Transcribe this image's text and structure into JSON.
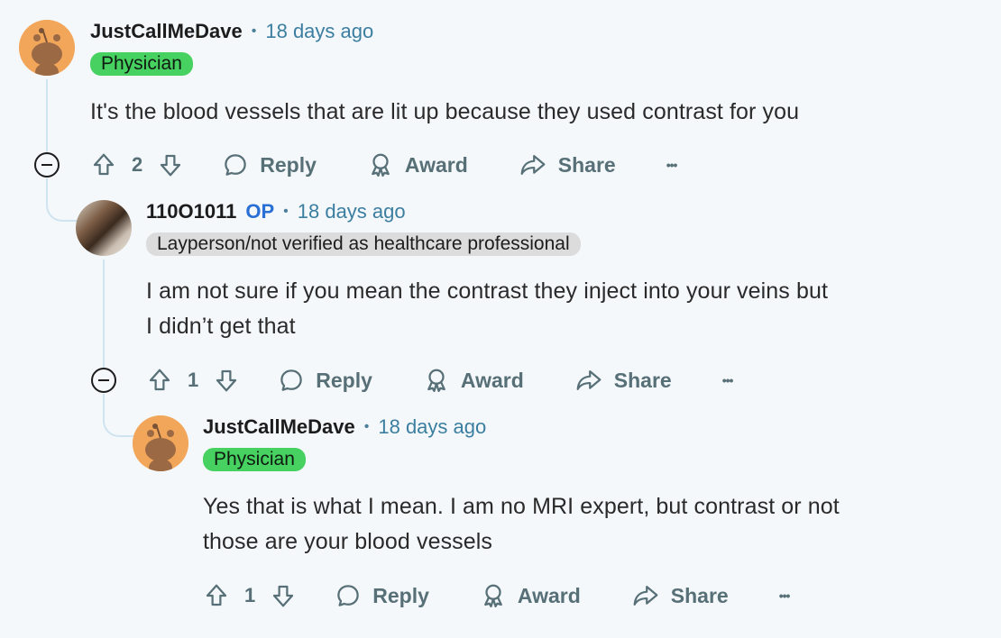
{
  "comments": [
    {
      "username": "JustCallMeDave",
      "separator": "•",
      "time": "18 days ago",
      "flair": "Physician",
      "body_lines": [
        "It's the blood vessels that are lit up because they used contrast for you"
      ],
      "votes": "2",
      "actions": {
        "reply": "Reply",
        "award": "Award",
        "share": "Share",
        "more": "•••"
      }
    },
    {
      "username": "110O1011",
      "op_badge": "OP",
      "separator": "•",
      "time": "18 days ago",
      "flair": "Layperson/not verified as healthcare professional",
      "body_lines": [
        "I am not sure if you mean the contrast they inject into your veins but",
        "I didn’t get that"
      ],
      "votes": "1",
      "actions": {
        "reply": "Reply",
        "award": "Award",
        "share": "Share",
        "more": "•••"
      }
    },
    {
      "username": "JustCallMeDave",
      "separator": "•",
      "time": "18 days ago",
      "flair": "Physician",
      "body_lines": [
        "Yes that is what I mean. I am no MRI expert, but contrast or not",
        "those are your blood vessels"
      ],
      "votes": "1",
      "actions": {
        "reply": "Reply",
        "award": "Award",
        "share": "Share",
        "more": "•••"
      }
    }
  ],
  "colors": {
    "background": "#f4f8fb",
    "flair_green": "#46d160",
    "flair_gray": "#dcdcdc",
    "op_blue": "#2a6fd6",
    "timestamp": "#3b7ea0",
    "action_gray": "#576f76",
    "thread_line": "#cfe3f0",
    "avatar_orange": "#f2a65a"
  },
  "icons": [
    "snoo-avatar-icon",
    "upvote-icon",
    "downvote-icon",
    "reply-bubble-icon",
    "award-icon",
    "share-arrow-icon",
    "more-options-icon",
    "collapse-minus-icon"
  ]
}
